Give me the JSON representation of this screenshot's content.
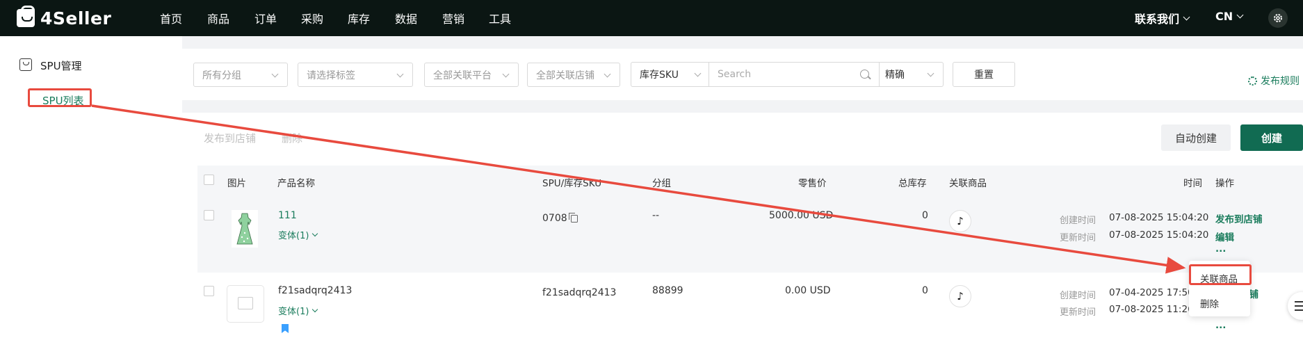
{
  "topbar": {
    "logo": "4Seller",
    "nav": [
      "首页",
      "商品",
      "订单",
      "采购",
      "库存",
      "数据",
      "营销",
      "工具"
    ],
    "contact": "联系我们",
    "lang": "CN"
  },
  "sidebar": {
    "section": "SPU管理",
    "item": "SPU列表"
  },
  "filters": {
    "group": "所有分组",
    "tag": "请选择标签",
    "platform": "全部关联平台",
    "store": "全部关联店铺",
    "sku_type": "库存SKU",
    "search_placeholder": "Search",
    "match_mode": "精确",
    "reset": "重置",
    "publish_rule": "发布规则"
  },
  "actions": {
    "publish": "发布到店铺",
    "delete": "删除",
    "auto_create": "自动创建",
    "create": "创建"
  },
  "table": {
    "headers": {
      "image": "图片",
      "name": "产品名称",
      "sku": "SPU/库存SKU",
      "group": "分组",
      "price": "零售价",
      "stock": "总库存",
      "linked": "关联商品",
      "time": "时间",
      "ops": "操作"
    },
    "rows": [
      {
        "name": "111",
        "variant": "变体(1)",
        "sku": "0708",
        "group": "--",
        "price": "5000.00 USD",
        "stock": "0",
        "created_label": "创建时间",
        "created": "07-08-2025 15:04:20",
        "updated_label": "更新时间",
        "updated": "07-08-2025 15:04:20",
        "op_publish": "发布到店铺",
        "op_edit": "编辑",
        "op_more": "..."
      },
      {
        "name": "f21sadqrq2413",
        "variant": "变体(1)",
        "sku": "f21sadqrq2413",
        "group": "88899",
        "price": "0.00 USD",
        "stock": "0",
        "created_label": "创建时间",
        "created": "07-04-2025 17:50",
        "updated_label": "更新时间",
        "updated": "07-08-2025 11:26",
        "op_publish_partial": "店铺",
        "op_more": "..."
      }
    ]
  },
  "dropdown": {
    "items": [
      "关联商品",
      "删除"
    ]
  },
  "icons": {
    "tiktok": "tiktok-icon"
  },
  "colors": {
    "brand": "#116b52",
    "link": "#1a7c5c",
    "annotation": "#e84a3e"
  }
}
